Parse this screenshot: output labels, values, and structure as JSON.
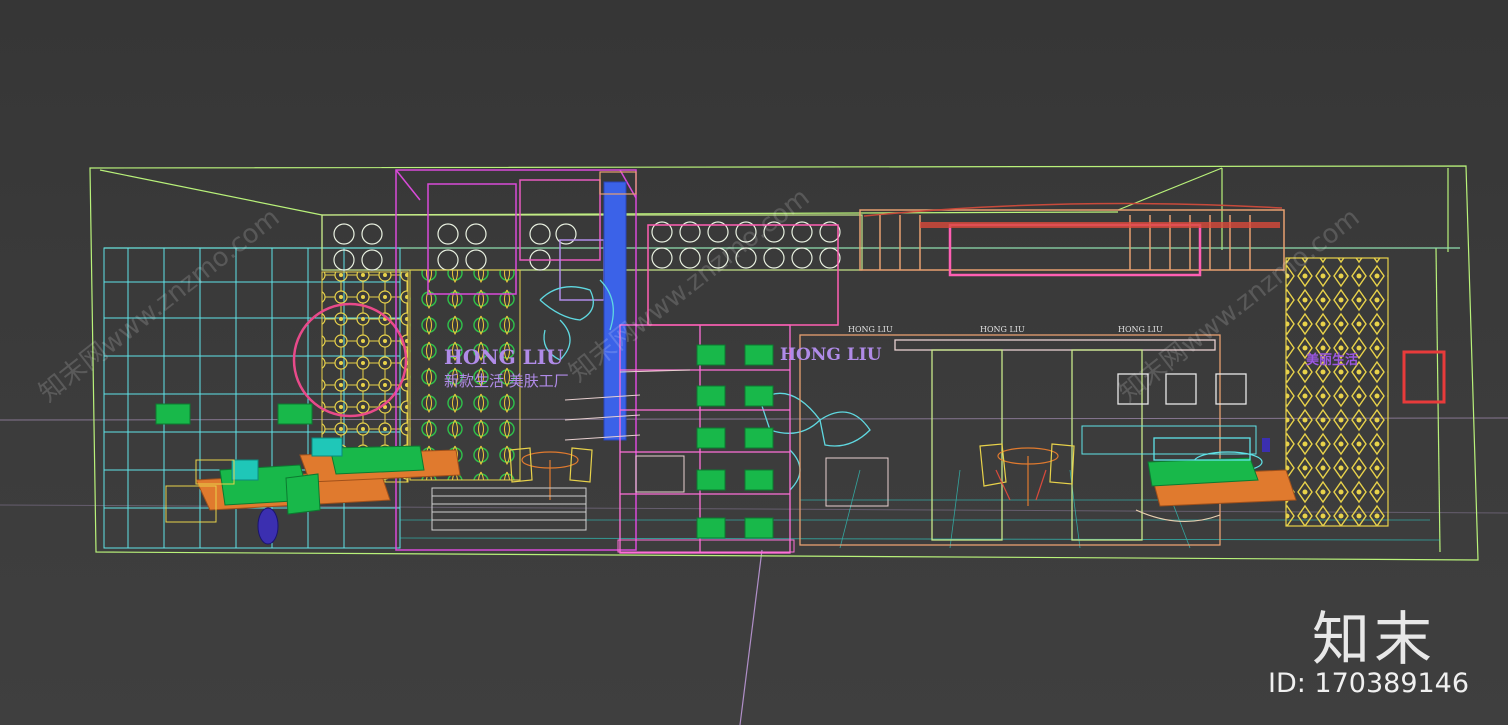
{
  "viewport": {
    "background": "#3a3a3a"
  },
  "watermark": {
    "text": "知末网www.znzmo.com"
  },
  "brand": {
    "logo": "知末",
    "id_label": "ID: 170389146"
  },
  "signage": {
    "main_brand": "HONG LIU",
    "sign_left_cn": "新款生活 美肤工厂",
    "sign_right_cn": "美丽生活",
    "shelf_label_1": "HONG LIU",
    "shelf_label_2": "HONG LIU",
    "shelf_label_3": "HONG LIU",
    "shelf_label_4": "HONG LIU"
  },
  "colors": {
    "frame": "#b9f27a",
    "cyan": "#5fe3e8",
    "yellow": "#e8d24a",
    "magenta": "#d94ad9",
    "purple": "#9b57e0",
    "pink": "#ff5fb3",
    "blue": "#3b62e8",
    "green": "#18b84a",
    "orange": "#e07a2e",
    "red": "#e83b3b",
    "teal": "#1fc7b8",
    "salmon": "#e8a070"
  }
}
